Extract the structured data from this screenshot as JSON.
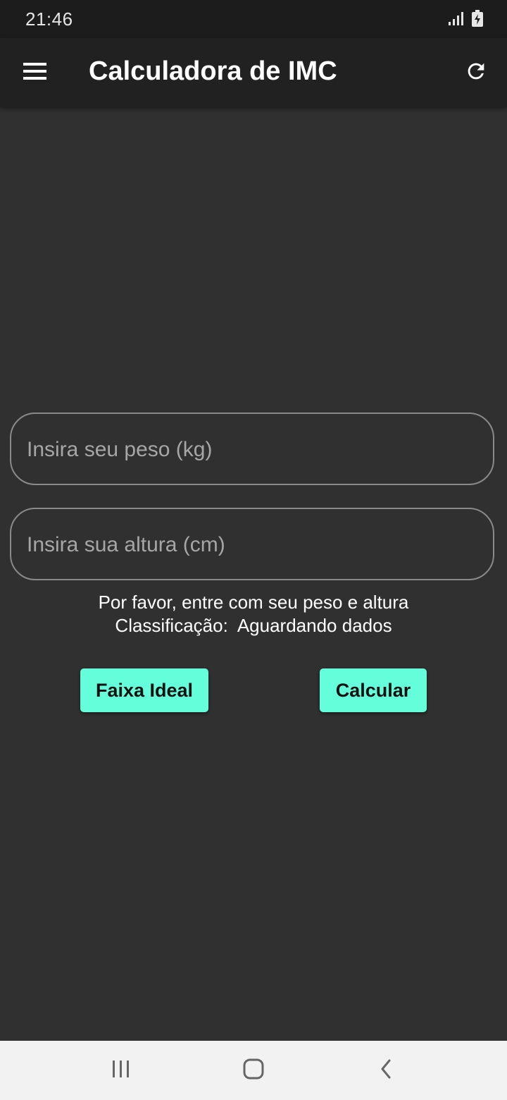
{
  "status_bar": {
    "time": "21:46",
    "icons": [
      "signal-icon",
      "battery-charging-icon"
    ]
  },
  "app_bar": {
    "title": "Calculadora de IMC",
    "left_icon": "menu-icon",
    "right_icon": "refresh-icon"
  },
  "form": {
    "weight_placeholder": "Insira seu peso (kg)",
    "weight_value": "",
    "height_placeholder": "Insira sua altura (cm)",
    "height_value": ""
  },
  "result": {
    "message": "Por favor, entre com seu peso e altura",
    "classification": "Classificação:  Aguardando dados"
  },
  "buttons": {
    "ideal_label": "Faixa Ideal",
    "calculate_label": "Calcular"
  },
  "nav_bar": {
    "icons": [
      "recents-icon",
      "home-icon",
      "back-icon"
    ]
  },
  "colors": {
    "accent": "#64ffda",
    "background": "#303030",
    "app_bar": "#212121",
    "status_bar": "#1c1c1c"
  }
}
